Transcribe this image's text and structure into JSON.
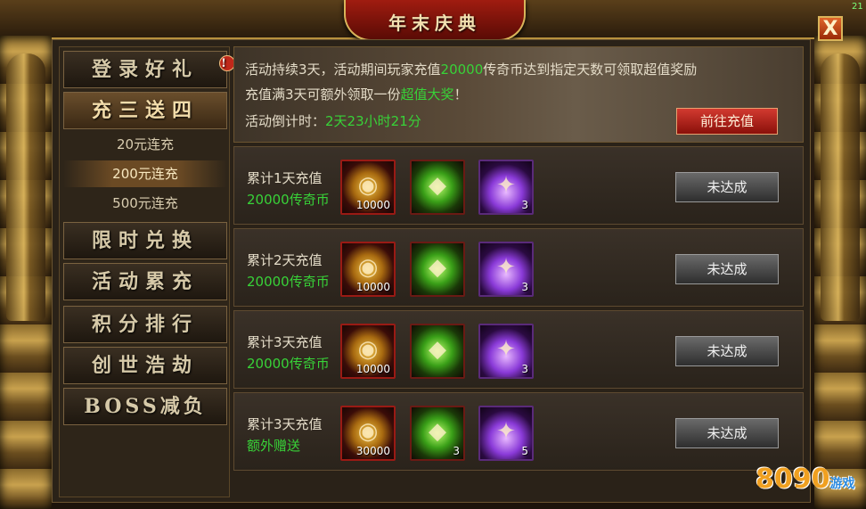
{
  "window": {
    "title": "年末庆典",
    "close_label": "X",
    "corner_text": "21"
  },
  "sidebar": {
    "items": [
      {
        "label": "登录好礼",
        "alert": "!"
      },
      {
        "label": "充三送四"
      },
      {
        "label": "限时兑换"
      },
      {
        "label": "活动累充"
      },
      {
        "label": "积分排行"
      },
      {
        "label": "创世浩劫"
      },
      {
        "label": "BOSS减负"
      }
    ],
    "sub_items": [
      {
        "label": "20元连充"
      },
      {
        "label": "200元连充"
      },
      {
        "label": "500元连充"
      }
    ]
  },
  "banner": {
    "line1_a": "活动持续3天，活动期间玩家充值",
    "line1_b": "20000",
    "line1_c": "传奇币达到指定天数可领取超值奖励",
    "line2_a": "充值满3天可额外领取一份",
    "line2_b": "超值大奖",
    "line2_c": "！",
    "line3_a": "活动倒计时：",
    "line3_b": "2天23小时21分",
    "recharge_label": "前往充值"
  },
  "rewards": [
    {
      "title": "累计1天充值",
      "sub": "20000传奇币",
      "items": [
        {
          "qty": "10000"
        },
        {
          "qty": ""
        },
        {
          "qty": "3"
        }
      ],
      "status": "未达成"
    },
    {
      "title": "累计2天充值",
      "sub": "20000传奇币",
      "items": [
        {
          "qty": "10000"
        },
        {
          "qty": ""
        },
        {
          "qty": "3"
        }
      ],
      "status": "未达成"
    },
    {
      "title": "累计3天充值",
      "sub": "20000传奇币",
      "items": [
        {
          "qty": "10000"
        },
        {
          "qty": ""
        },
        {
          "qty": "3"
        }
      ],
      "status": "未达成"
    },
    {
      "title": "累计3天充值",
      "sub": "额外赠送",
      "items": [
        {
          "qty": "30000"
        },
        {
          "qty": "3"
        },
        {
          "qty": "5"
        }
      ],
      "status": "未达成"
    }
  ],
  "watermark": {
    "brand": "8090",
    "brand_sub": "游戏"
  },
  "icons": {
    "gold": "gold-coin-icon",
    "green": "green-gem-icon",
    "purple": "purple-crystal-icon"
  }
}
